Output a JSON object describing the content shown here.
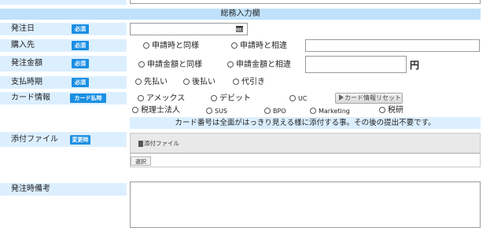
{
  "section": {
    "title": "総務入力欄"
  },
  "fields": {
    "order_date": {
      "label": "発注日",
      "badge": "必須",
      "value": ""
    },
    "supplier": {
      "label": "購入先",
      "badge": "必須",
      "options": [
        "申請時と同様",
        "申請時と相違"
      ],
      "text_value": ""
    },
    "amount": {
      "label": "発注金額",
      "badge": "必須",
      "options": [
        "申請金額と同様",
        "申請金額と相違"
      ],
      "text_value": "",
      "unit": "円"
    },
    "payment_timing": {
      "label": "支払時期",
      "badge": "必須",
      "options": [
        "先払い",
        "後払い",
        "代引き"
      ]
    },
    "card_info": {
      "label": "カード情報",
      "badge": "カード払時",
      "options_row1": [
        "アメックス",
        "デビット",
        "UC"
      ],
      "reset_button": "カード情報リセット",
      "options_row2": [
        "税理士法人",
        "SUS",
        "BPO",
        "Marketing",
        "税研"
      ],
      "note": "カード番号は全面がはっきり見える様に添付する事。その後の提出不要です。"
    },
    "attachment": {
      "label": "添付ファイル",
      "badge": "変更時",
      "drop_label": "添付ファイル",
      "select_button": "選択"
    },
    "remarks": {
      "label": "発注時備考",
      "value": ""
    }
  },
  "colors": {
    "label_bg": "#dcefff",
    "badge_bg": "#1a8fe3",
    "section_bg": "#bfe1fb"
  }
}
